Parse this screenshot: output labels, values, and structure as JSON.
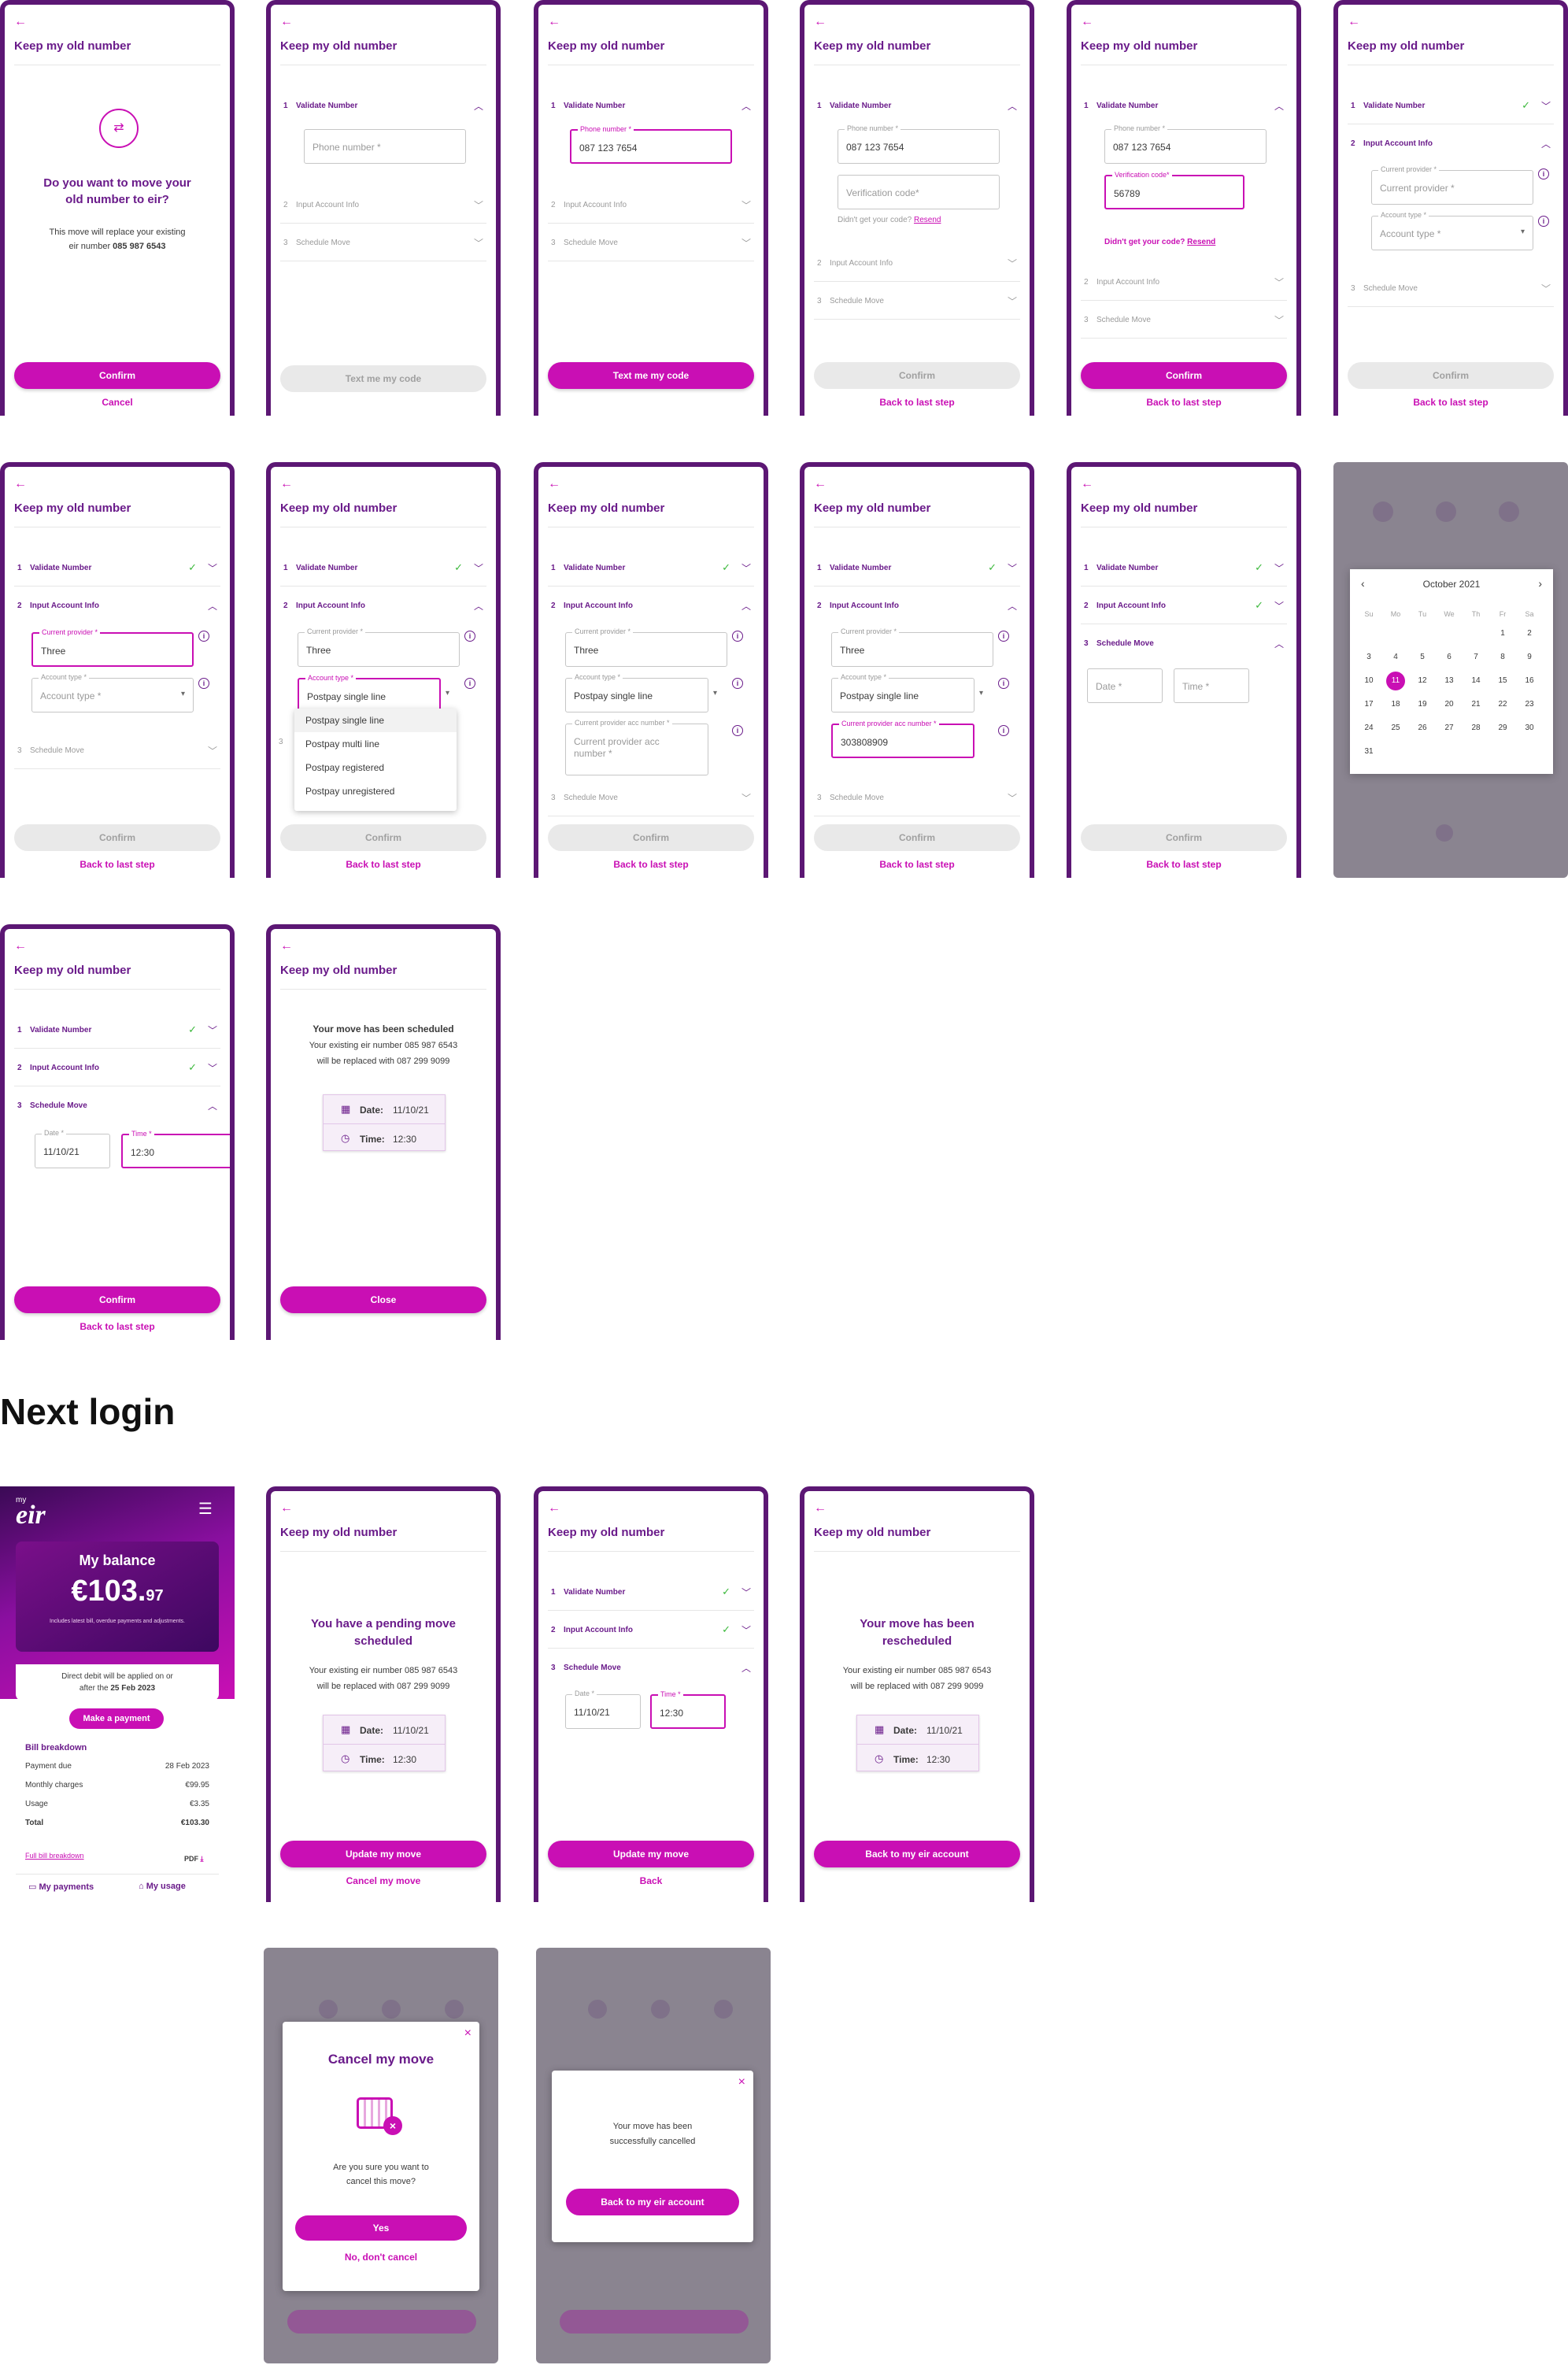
{
  "common": {
    "title": "Keep my old number",
    "back_arrow": "←",
    "confirm": "Confirm",
    "back_to_last": "Back to last step",
    "cancel": "Cancel",
    "text_code": "Text me my code"
  },
  "steps": {
    "s1_num": "1",
    "s1": "Validate Number",
    "s2_num": "2",
    "s2": "Input Account Info",
    "s3_num": "3",
    "s3": "Schedule Move"
  },
  "s1": {
    "question": "Do you want to move your old number to eir?",
    "desc1": "This move will replace your existing",
    "desc2": "eir number",
    "num": "085 987 6543"
  },
  "fields": {
    "phone_label": "Phone number *",
    "phone_value": "087 123 7654",
    "verify_label": "Verification code*",
    "verify_value": "56789",
    "didnt_get": "Didn't get your code?",
    "resend": "Resend",
    "provider_label": "Current provider *",
    "provider_value": "Three",
    "acct_type_label": "Account type *",
    "acct_type_value": "Postpay single line",
    "acc_num_label": "Current provider acc number *",
    "acc_num_value": "303808909",
    "date_label": "Date *",
    "date_value": "11/10/21",
    "time_label": "Time *",
    "time_value": "12:30"
  },
  "dropdown": [
    "Postpay single line",
    "Postpay multi line",
    "Postpay registered",
    "Postpay unregistered"
  ],
  "calendar": {
    "month": "October 2021",
    "weekdays": [
      "Su",
      "Mo",
      "Tu",
      "We",
      "Th",
      "Fr",
      "Sa"
    ],
    "days": [
      "1",
      "2",
      "3",
      "4",
      "5",
      "6",
      "7",
      "8",
      "9",
      "10",
      "11",
      "12",
      "13",
      "14",
      "15",
      "16",
      "17",
      "18",
      "19",
      "20",
      "21",
      "22",
      "23",
      "24",
      "25",
      "26",
      "27",
      "28",
      "29",
      "30",
      "31"
    ],
    "selected": "11"
  },
  "scheduled": {
    "title": "Your move has been scheduled",
    "line1": "Your existing eir number 085 987 6543",
    "line2": "will be replaced with 087 299 9099",
    "date_label": "Date:",
    "date": "11/10/21",
    "time_label": "Time:",
    "time": "12:30",
    "close": "Close"
  },
  "section_heading": "Next login",
  "account": {
    "logo": "eir",
    "logo_prefix": "my",
    "balance_label": "My balance",
    "balance_main": "€103.",
    "balance_cents": "97",
    "balance_note": "Includes latest bill, overdue payments and adjustments.",
    "dd_line1": "Direct debit will be applied on or",
    "dd_line2a": "after the",
    "dd_line2b": "25 Feb 2023",
    "make_payment": "Make a payment",
    "bill_breakdown": "Bill breakdown",
    "rows": [
      {
        "l": "Payment due",
        "v": "28 Feb 2023"
      },
      {
        "l": "Monthly charges",
        "v": "€99.95"
      },
      {
        "l": "Usage",
        "v": "€3.35"
      },
      {
        "l": "Total",
        "v": "€103.30"
      }
    ],
    "full_bill": "Full bill breakdown",
    "pdf": "PDF",
    "my_payments": "My payments",
    "my_usage": "My usage"
  },
  "pending": {
    "title1": "You have a pending  move",
    "title2": "scheduled",
    "update": "Update my move",
    "cancel": "Cancel my move"
  },
  "update": {
    "update_btn": "Update my move",
    "back": "Back"
  },
  "rescheduled": {
    "title1": "Your move has been",
    "title2": "rescheduled",
    "back_acc": "Back to my eir account"
  },
  "cancel_modal": {
    "title": "Cancel my move",
    "q1": "Are you sure you want to",
    "q2": "cancel this move?",
    "yes": "Yes",
    "no": "No, don't cancel"
  },
  "cancelled_modal": {
    "l1": "Your move has been",
    "l2": "successfully cancelled",
    "btn": "Back to my eir account"
  },
  "colors": {
    "brand_purple": "#5c1774",
    "accent_magenta": "#c90fb4",
    "check_green": "#3cb83c"
  }
}
